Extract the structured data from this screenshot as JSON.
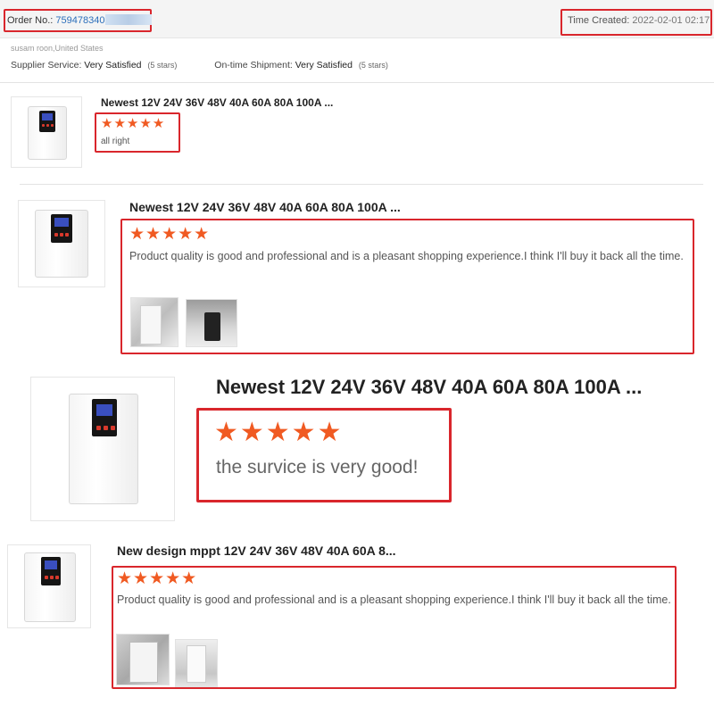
{
  "order": {
    "label": "Order No.:",
    "number": "759478340"
  },
  "time": {
    "label": "Time Created:",
    "value": "2022-02-01 02:17"
  },
  "buyer_location": "susam roon,United States",
  "ratings": {
    "supplier_label": "Supplier Service:",
    "supplier_value": "Very Satisfied",
    "supplier_stars": "(5 stars)",
    "shipment_label": "On-time Shipment:",
    "shipment_value": "Very Satisfied",
    "shipment_stars": "(5 stars)"
  },
  "reviews": [
    {
      "title": "Newest 12V 24V 36V 48V 40A 60A 80A 100A ...",
      "stars": "★★★★★",
      "rating": 5,
      "text": "all right"
    },
    {
      "title": "Newest 12V 24V 36V 48V 40A 60A 80A 100A ...",
      "stars": "★★★★★",
      "rating": 5,
      "text": "Product quality is good and professional and is a pleasant shopping experience.I think I'll buy it back all the time."
    },
    {
      "title": "Newest 12V 24V 36V 48V 40A 60A 80A 100A ...",
      "stars": "★★★★★",
      "rating": 5,
      "text": "the survice is very good!"
    },
    {
      "title": "New design mppt 12V 24V 36V 48V 40A 60A 8...",
      "stars": "★★★★★",
      "rating": 5,
      "text": "Product quality is good and professional and is a pleasant shopping experience.I think I'll buy it back all the time."
    }
  ],
  "colors": {
    "highlight": "#d9262c",
    "star": "#f05a22",
    "link": "#2c6fbb"
  }
}
